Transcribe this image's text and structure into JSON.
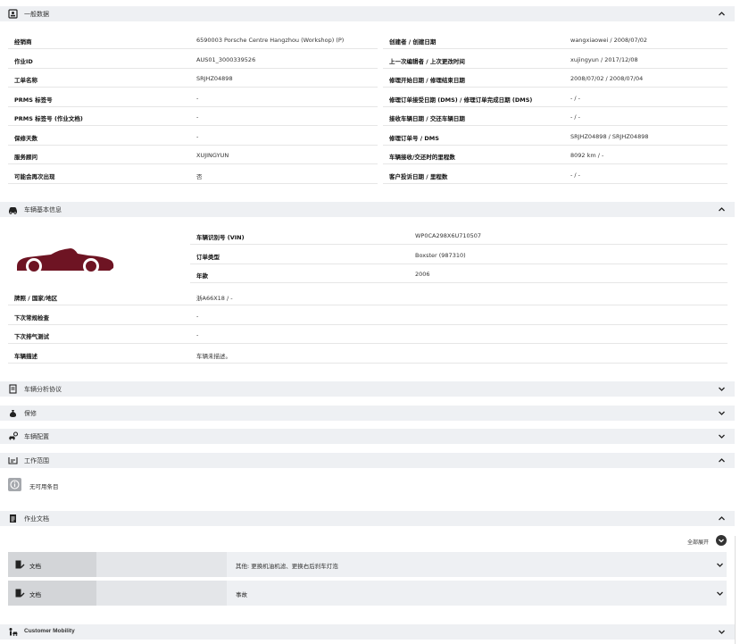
{
  "general": {
    "title": "一般数据",
    "left_rows": [
      {
        "label": "经销商",
        "value": "6590003 Porsche Centre Hangzhou (Workshop) (P)"
      },
      {
        "label": "作业ID",
        "value": "AUS01_3000339526"
      },
      {
        "label": "工单名称",
        "value": "SRJHZ04898"
      },
      {
        "label": "PRMS 标签号",
        "value": "-"
      },
      {
        "label": "PRMS 标签号 (作业文档)",
        "value": "-"
      },
      {
        "label": "保修天数",
        "value": "-"
      },
      {
        "label": "服务顾问",
        "value": "XUJINGYUN"
      },
      {
        "label": "可能会再次出现",
        "value": "否"
      }
    ],
    "right_rows": [
      {
        "label": "创建者 / 创建日期",
        "value": "wangxiaowei / 2008/07/02"
      },
      {
        "label": "上一次编辑者 / 上次更改时间",
        "value": "xujingyun / 2017/12/08"
      },
      {
        "label": "修理开始日期 / 修理结束日期",
        "value": "2008/07/02 / 2008/07/04"
      },
      {
        "label": "修理订单接受日期 (DMS) / 修理订单完成日期 (DMS)",
        "value": "- / -"
      },
      {
        "label": "接收车辆日期 / 交还车辆日期",
        "value": "- / -"
      },
      {
        "label": "修理订单号 / DMS",
        "value": "SRJHZ04898 / SRJHZ04898"
      },
      {
        "label": "车辆接收/交还时的里程数",
        "value": "8092 km / -"
      },
      {
        "label": "客户投诉日期 / 里程数",
        "value": "- / -"
      }
    ]
  },
  "vehicle": {
    "title": "车辆基本信息",
    "top_rows": [
      {
        "label": "车辆识别号 (VIN)",
        "value": "WP0CA298X6U710507"
      },
      {
        "label": "订单类型",
        "value": "Boxster (987310)"
      },
      {
        "label": "年款",
        "value": "2006"
      }
    ],
    "bottom_rows": [
      {
        "label": "牌照 / 国家/地区",
        "value": "浙A66X18 / -"
      },
      {
        "label": "下次常规检查",
        "value": "-"
      },
      {
        "label": "下次排气测试",
        "value": "-"
      },
      {
        "label": "车辆描述",
        "value": "车辆未描述。"
      }
    ]
  },
  "sections": {
    "analysis": "车辆分析协议",
    "warranty": "保修",
    "config": "车辆配置",
    "scope": "工作范围",
    "scope_empty": "无可用条目",
    "docs": "作业文档",
    "expand_all": "全部展开",
    "doc_items": [
      {
        "label": "文档",
        "desc": "其他: 更换机油机滤、更换右后刹车灯泡"
      },
      {
        "label": "文档",
        "desc": "事故"
      }
    ],
    "mobility": "Customer Mobility"
  },
  "colors": {
    "car": "#6e1423",
    "header_bg": "#eef0f3"
  }
}
